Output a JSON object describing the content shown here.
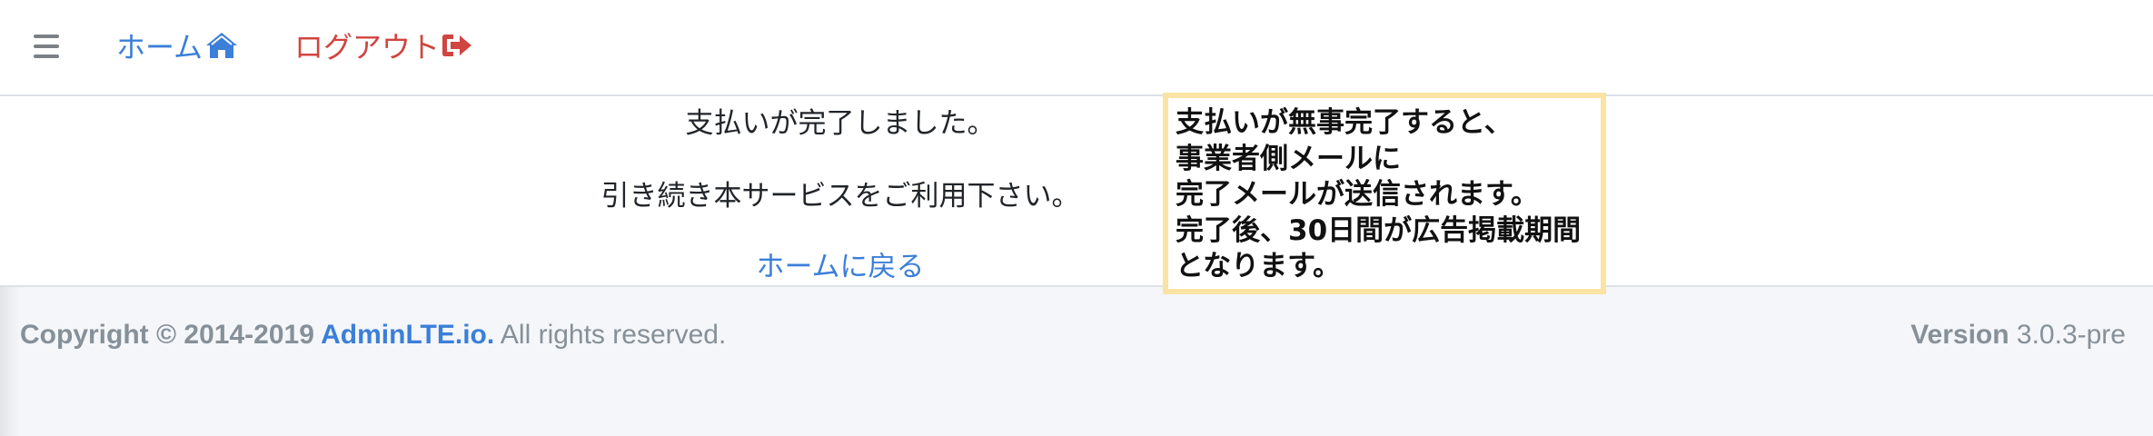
{
  "navbar": {
    "menu_icon": "bars-icon",
    "home_label": "ホーム",
    "home_icon": "home-icon",
    "logout_label": "ログアウト",
    "logout_icon": "sign-out-icon",
    "home_color": "#3b7fd9",
    "logout_color": "#d0453f"
  },
  "content": {
    "message_line1": "支払いが完了しました。",
    "message_line2": "引き続き本サービスをご利用下さい。",
    "home_back_link": "ホームに戻る"
  },
  "note": {
    "lines": [
      "支払いが無事完了すると、",
      "事業者側メールに",
      "完了メールが送信されます。",
      "完了後、30日間が広告掲載期間",
      "となります。"
    ],
    "border_color": "#fbe3a4"
  },
  "footer": {
    "copyright_prefix": "Copyright © 2014-2019 ",
    "brand_link": "AdminLTE.io.",
    "rights": " All rights reserved.",
    "version_label": "Version",
    "version_value": " 3.0.3-pre"
  }
}
